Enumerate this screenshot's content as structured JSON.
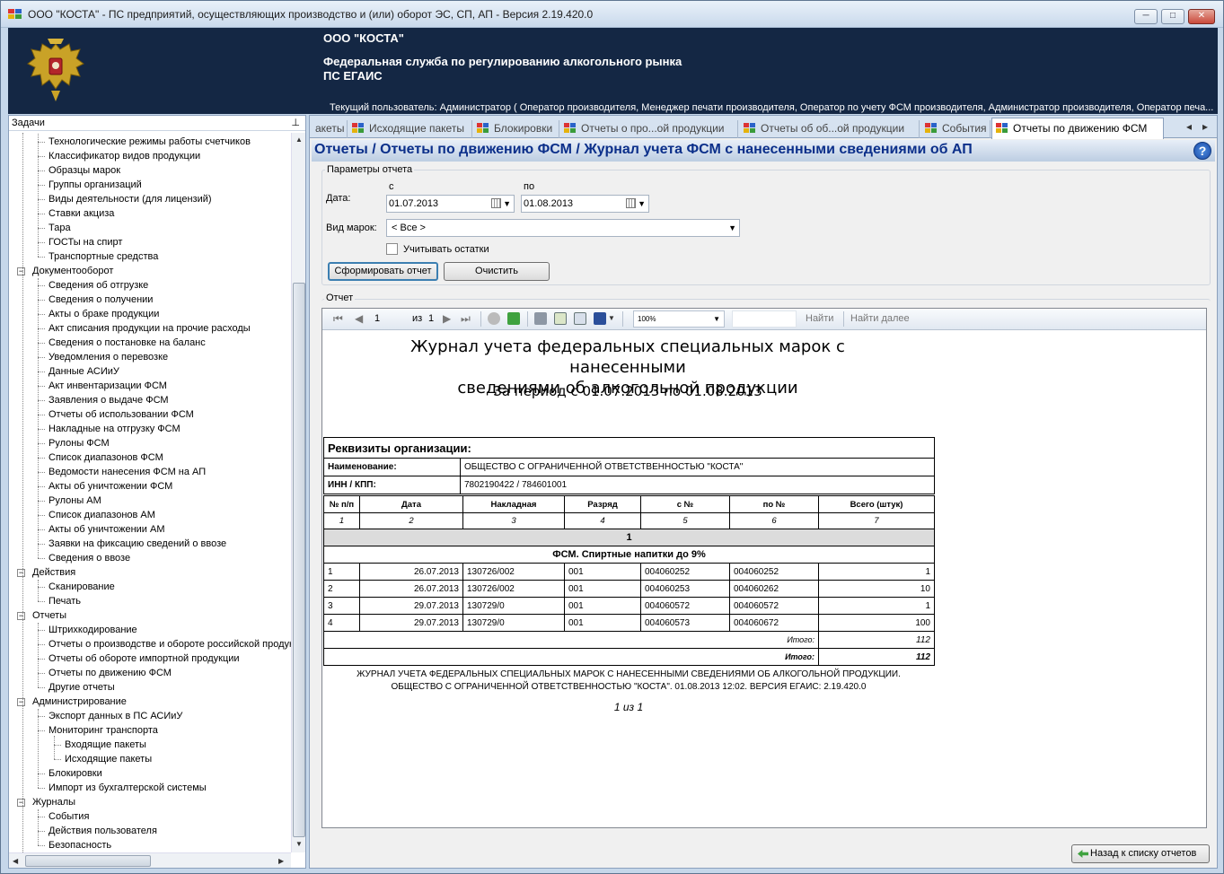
{
  "window": {
    "title": "ООО \"КОСТА\" - ПС предприятий, осуществляющих производство и (или) оборот ЭС, СП, АП - Версия 2.19.420.0",
    "minimize": "─",
    "maximize": "□",
    "close": "✕"
  },
  "banner": {
    "org_name": "ООО \"КОСТА\"",
    "agency_line1": "Федеральная служба по регулированию алкогольного рынка",
    "agency_line2": "ПС ЕГАИС",
    "current_user": "Текущий пользователь: Администратор ( Оператор производителя, Менеджер печати производителя, Оператор по учету ФСМ производителя, Администратор производителя, Оператор печа..."
  },
  "tasks": {
    "header": "Задачи",
    "pin": "ㅁ",
    "items": [
      {
        "label": "Технологические режимы работы счетчиков",
        "level": 2
      },
      {
        "label": "Классификатор видов продукции",
        "level": 2
      },
      {
        "label": "Образцы марок",
        "level": 2
      },
      {
        "label": "Группы организаций",
        "level": 2
      },
      {
        "label": "Виды деятельности (для лицензий)",
        "level": 2
      },
      {
        "label": "Ставки акциза",
        "level": 2
      },
      {
        "label": "Тара",
        "level": 2
      },
      {
        "label": "ГОСТы на спирт",
        "level": 2
      },
      {
        "label": "Транспортные средства",
        "level": 2
      },
      {
        "label": "Документооборот",
        "level": 1
      },
      {
        "label": "Сведения об отгрузке",
        "level": 2
      },
      {
        "label": "Сведения о получении",
        "level": 2
      },
      {
        "label": "Акты о браке продукции",
        "level": 2
      },
      {
        "label": "Акт списания продукции на прочие расходы",
        "level": 2
      },
      {
        "label": "Сведения о постановке на баланс",
        "level": 2
      },
      {
        "label": "Уведомления о перевозке",
        "level": 2
      },
      {
        "label": "Данные АСИиУ",
        "level": 2
      },
      {
        "label": "Акт инвентаризации ФСМ",
        "level": 2
      },
      {
        "label": "Заявления о выдаче ФСМ",
        "level": 2
      },
      {
        "label": "Отчеты об использовании ФСМ",
        "level": 2
      },
      {
        "label": "Накладные на отгрузку ФСМ",
        "level": 2
      },
      {
        "label": "Рулоны ФСМ",
        "level": 2
      },
      {
        "label": "Список диапазонов ФСМ",
        "level": 2
      },
      {
        "label": "Ведомости нанесения ФСМ на АП",
        "level": 2
      },
      {
        "label": "Акты об уничтожении ФСМ",
        "level": 2
      },
      {
        "label": "Рулоны АМ",
        "level": 2
      },
      {
        "label": "Список диапазонов АМ",
        "level": 2
      },
      {
        "label": "Акты об уничтожении АМ",
        "level": 2
      },
      {
        "label": "Заявки на фиксацию сведений о ввозе",
        "level": 2
      },
      {
        "label": "Сведения о ввозе",
        "level": 2
      },
      {
        "label": "Действия",
        "level": 1
      },
      {
        "label": "Сканирование",
        "level": 2
      },
      {
        "label": "Печать",
        "level": 2
      },
      {
        "label": "Отчеты",
        "level": 1
      },
      {
        "label": "Штрихкодирование",
        "level": 2
      },
      {
        "label": "Отчеты о производстве и обороте российской продукции",
        "level": 2
      },
      {
        "label": "Отчеты об обороте импортной продукции",
        "level": 2
      },
      {
        "label": "Отчеты по движению ФСМ",
        "level": 2
      },
      {
        "label": "Другие отчеты",
        "level": 2
      },
      {
        "label": "Администрирование",
        "level": 1
      },
      {
        "label": "Экспорт данных в ПС АСИиУ",
        "level": 2
      },
      {
        "label": "Мониторинг транспорта",
        "level": 2
      },
      {
        "label": "Входящие пакеты",
        "level": 3
      },
      {
        "label": "Исходящие пакеты",
        "level": 3
      },
      {
        "label": "Блокировки",
        "level": 2
      },
      {
        "label": "Импорт из бухгалтерской системы",
        "level": 2
      },
      {
        "label": "Журналы",
        "level": 1
      },
      {
        "label": "События",
        "level": 2
      },
      {
        "label": "Действия пользователя",
        "level": 2
      },
      {
        "label": "Безопасность",
        "level": 2
      }
    ]
  },
  "tabs": [
    {
      "label": "акеты"
    },
    {
      "label": "Исходящие пакеты"
    },
    {
      "label": "Блокировки"
    },
    {
      "label": "Отчеты о про...ой продукции"
    },
    {
      "label": "Отчеты об об...ой продукции"
    },
    {
      "label": "События"
    },
    {
      "label": "Отчеты по движению ФСМ"
    }
  ],
  "tab_nav": {
    "prev": "◂",
    "next": "▸"
  },
  "report": {
    "title": "Отчеты / Отчеты по движению ФСМ / Журнал учета ФСМ с нанесенными сведениями об АП",
    "help": "?"
  },
  "params": {
    "group_label": "Параметры отчета",
    "date_label": "Дата:",
    "from_label": "с",
    "to_label": "по",
    "from_value": "01.07.2013",
    "to_value": "01.08.2013",
    "marks_label": "Вид марок:",
    "marks_value": "< Все >",
    "remains_label": "Учитывать остатки",
    "generate_button": "Сформировать отчет",
    "clear_button": "Очистить"
  },
  "viewer": {
    "group_label": "Отчет",
    "page_value": "1",
    "of_label": "из",
    "of_value": "1",
    "zoom": "100%",
    "find": "Найти",
    "find_next": "Найти далее",
    "doc_title_line1": "Журнал учета федеральных специальных марок с нанесенными",
    "doc_title_line2": "сведениями об алкогольной продукции",
    "doc_period": "За период с 01.07.2013 по 01.08.2013",
    "req_header": "Реквизиты организации:",
    "req_name_label": "Наименование:",
    "req_name_value": "ОБЩЕСТВО С ОГРАНИЧЕННОЙ ОТВЕТСТВЕННОСТЬЮ \"КОСТА\"",
    "req_inn_label": "ИНН / КПП:",
    "req_inn_value": "7802190422 / 784601001",
    "columns": [
      "№ п/п",
      "Дата",
      "Накладная",
      "Разряд",
      "с №",
      "по №",
      "Всего (штук)"
    ],
    "column_numbers": [
      "1",
      "2",
      "3",
      "4",
      "5",
      "6",
      "7"
    ],
    "group_number": "1",
    "group_name": "ФСМ. Спиртные напитки до 9%",
    "rows": [
      {
        "n": "1",
        "date": "26.07.2013",
        "invoice": "130726/002",
        "rank": "001",
        "from": "004060252",
        "to": "004060252",
        "total": "1"
      },
      {
        "n": "2",
        "date": "26.07.2013",
        "invoice": "130726/002",
        "rank": "001",
        "from": "004060253",
        "to": "004060262",
        "total": "10"
      },
      {
        "n": "3",
        "date": "29.07.2013",
        "invoice": "130729/0",
        "rank": "001",
        "from": "004060572",
        "to": "004060572",
        "total": "1"
      },
      {
        "n": "4",
        "date": "29.07.2013",
        "invoice": "130729/0",
        "rank": "001",
        "from": "004060573",
        "to": "004060672",
        "total": "100"
      }
    ],
    "subtotal_label": "Итого:",
    "subtotal_value": "112",
    "total_label": "Итого:",
    "total_value": "112",
    "footer_line1": "ЖУРНАЛ УЧЕТА ФЕДЕРАЛЬНЫХ СПЕЦИАЛЬНЫХ МАРОК С НАНЕСЕННЫМИ СВЕДЕНИЯМИ ОБ АЛКОГОЛЬНОЙ ПРОДУКЦИИ.",
    "footer_line2": "ОБЩЕСТВО С ОГРАНИЧЕННОЙ ОТВЕТСТВЕННОСТЬЮ \"КОСТА\". 01.08.2013 12:02. ВЕРСИЯ ЕГАИС: 2.19.420.0",
    "page_footer": "1 из 1"
  },
  "back_button": "Назад к списку отчетов",
  "icons": {
    "app": "app-icon",
    "emblem": "emblem-icon",
    "first": "first-page-icon",
    "prev": "prev-page-icon",
    "next": "next-page-icon",
    "last": "last-page-icon",
    "stop": "stop-icon",
    "refresh": "refresh-icon",
    "print": "print-icon",
    "layout": "print-layout-icon",
    "pagesetup": "page-setup-icon",
    "save": "save-icon"
  },
  "colors": {
    "banner": "#142744",
    "report_title": "#0b2f8a",
    "accent": "#3c7fb1"
  }
}
